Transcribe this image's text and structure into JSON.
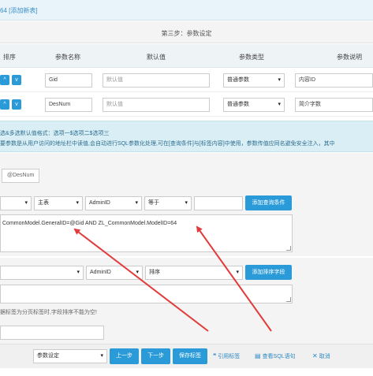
{
  "header": {
    "title": "64 [添加新表]"
  },
  "step": {
    "label": "第三步：参数设定"
  },
  "table_head": {
    "sort": "排序",
    "name": "参数名称",
    "default": "默认值",
    "type": "参数类型",
    "desc": "参数说明"
  },
  "params": [
    {
      "up": "^",
      "down": "v",
      "name": "Gid",
      "default_placeholder": "默认值",
      "type": "普通参数",
      "desc": "内容ID"
    },
    {
      "up": "^",
      "down": "v",
      "name": "DesNum",
      "default_placeholder": "默认值",
      "type": "普通参数",
      "desc": "简介字数"
    }
  ],
  "info": {
    "line1": "选&多选默认值格式：选项一$选项二$选项三",
    "line2": "要参数是从用户访问的地址栏中读值,会自动进行SQL参数化处理,可在[查询条件]与[标签内容]中使用，参数传值应同名避免安全注入，其中"
  },
  "chip": {
    "label": "@DesNum"
  },
  "where_row": {
    "table": "主表",
    "field": "AdminID",
    "op": "等于",
    "add_label": "添加查询条件"
  },
  "where_sql": "CommonModel.GeneralID=@Gid AND ZL_CommonModel.ModelID=64",
  "order_row": {
    "field": "AdminID",
    "dir": "排序",
    "add_label": "添加排序字段"
  },
  "hint": "据标签为分页标签时,字段排序不能为空!",
  "bottom": {
    "select": "参数设定",
    "prev": "上一步",
    "next": "下一步",
    "save": "保存标签",
    "ref_label": "引用标签",
    "ref_icon": "quote-icon",
    "sql_label": "查看SQL语句",
    "sql_icon": "code-icon",
    "cancel_label": "取消",
    "cancel_icon": "cancel-icon"
  },
  "colors": {
    "accent": "#2a9bd8",
    "info_bg": "#daeef6",
    "annotation": "#e23b3b"
  }
}
